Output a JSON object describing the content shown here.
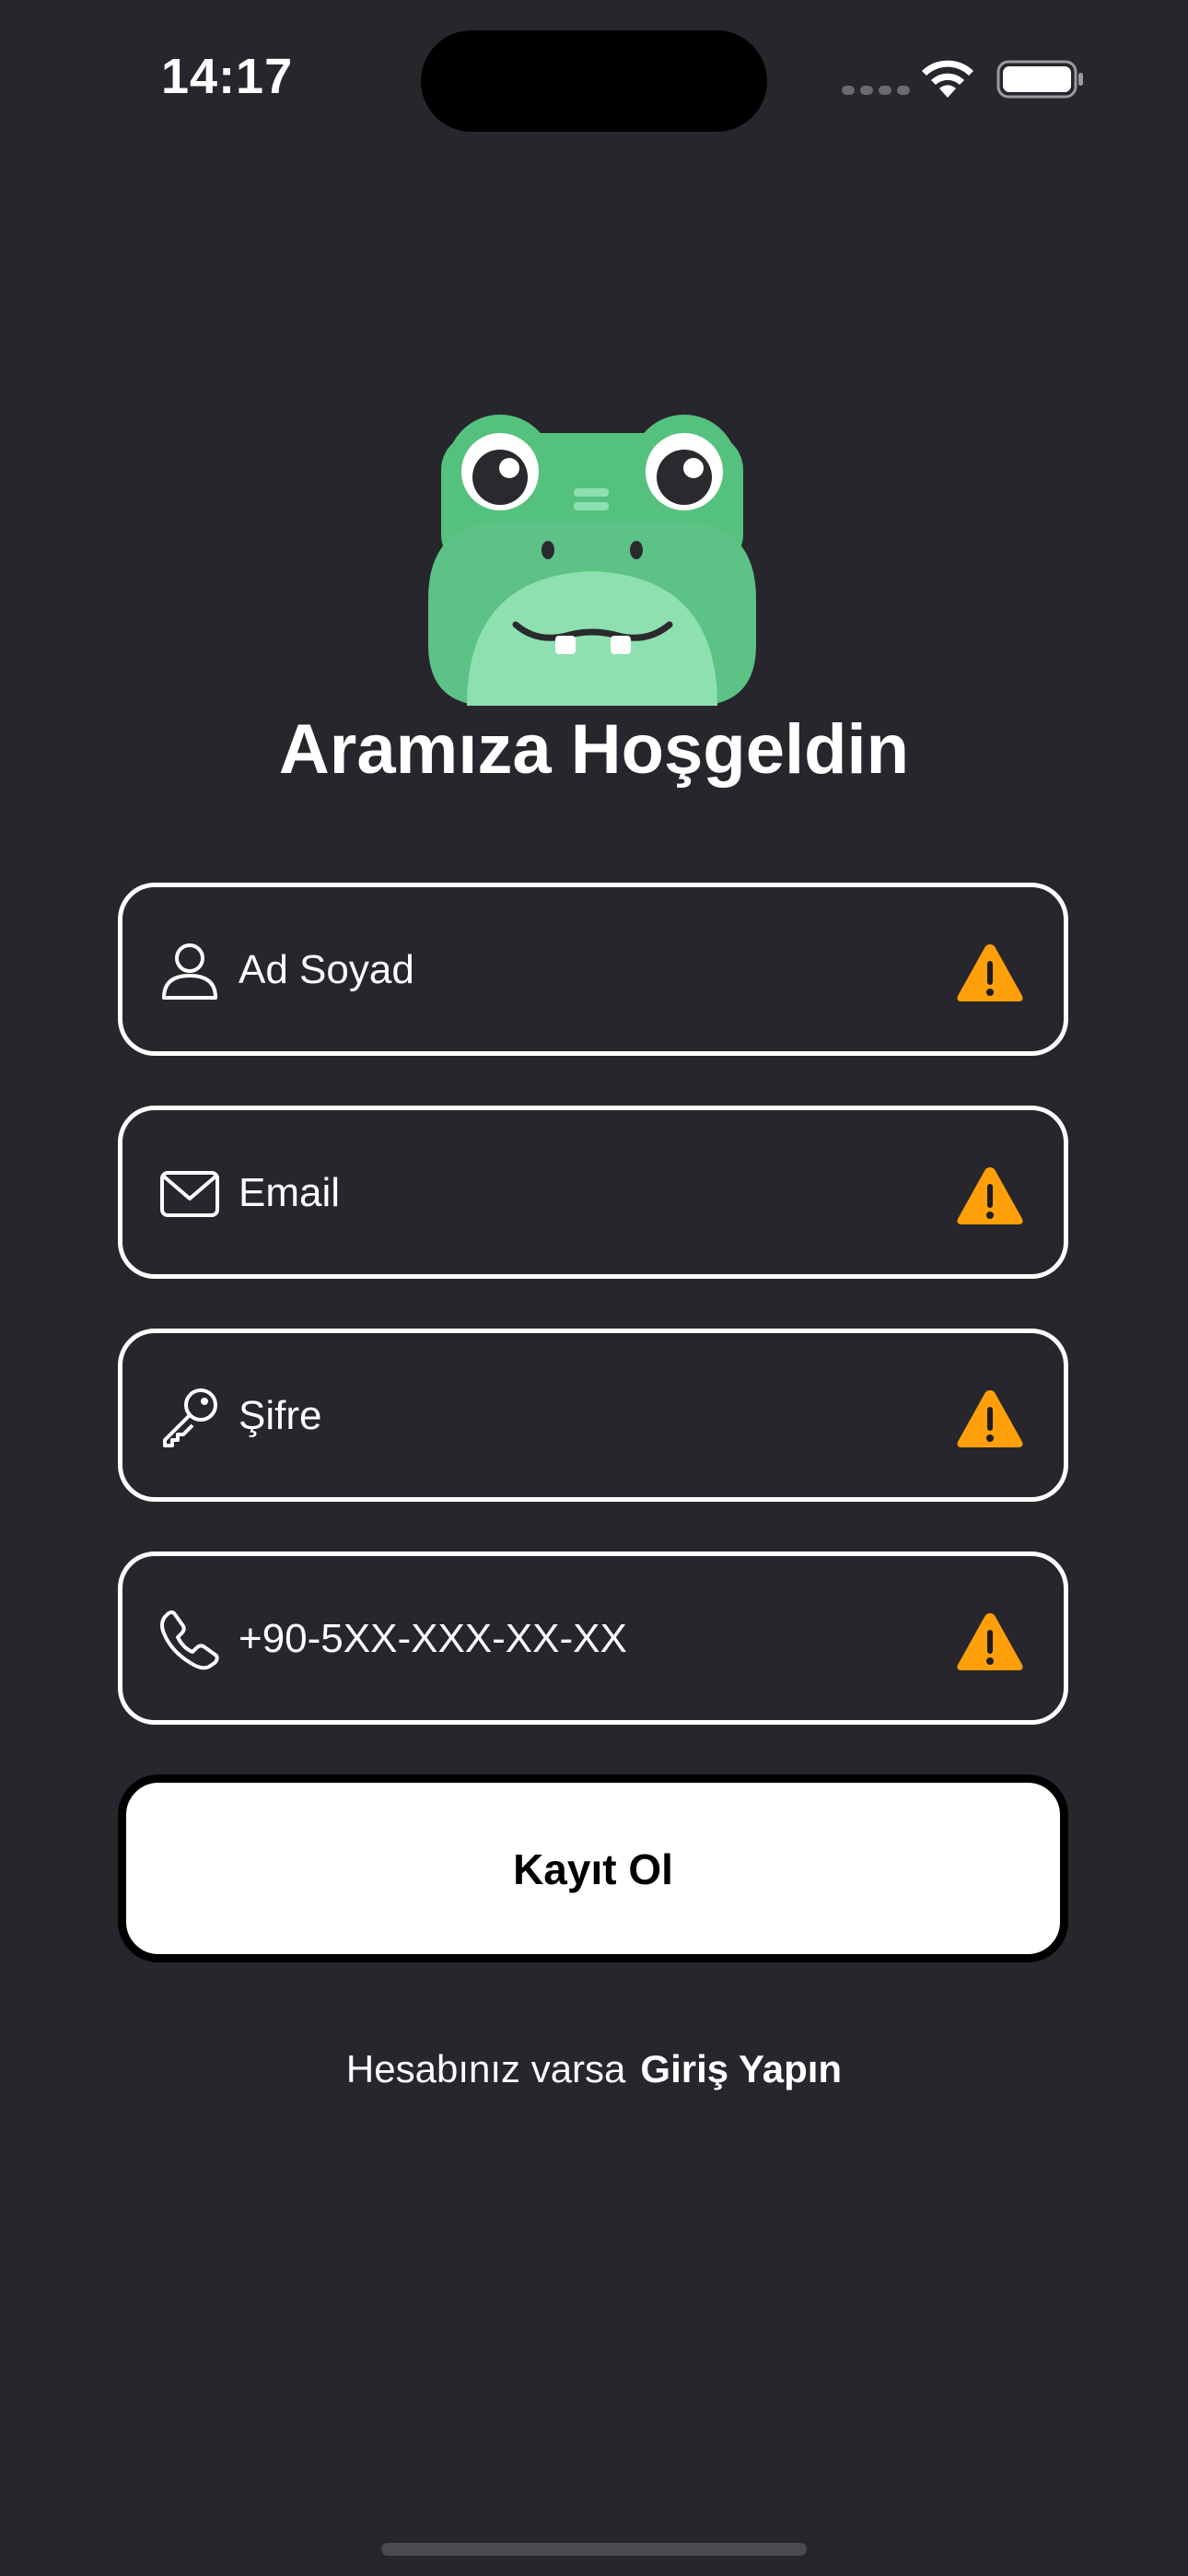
{
  "status_bar": {
    "time": "14:17"
  },
  "logo": {
    "name": "frog-mascot"
  },
  "title": "Aramıza Hoşgeldin",
  "form": {
    "name_placeholder": "Ad Soyad",
    "email_placeholder": "Email",
    "password_placeholder": "Şifre",
    "phone_placeholder": "+90-5XX-XXX-XX-XX",
    "submit_label": "Kayıt Ol"
  },
  "footer": {
    "prompt": "Hesabınız varsa",
    "login_link": "Giriş Yapın"
  },
  "colors": {
    "background": "#26262C",
    "warning": "#FF9F0A",
    "frog_dark": "#55C17E",
    "frog_light": "#8EE0B0"
  },
  "icons": [
    "person-icon",
    "mail-icon",
    "key-icon",
    "phone-icon",
    "warning-icon",
    "wifi-icon",
    "battery-icon"
  ]
}
